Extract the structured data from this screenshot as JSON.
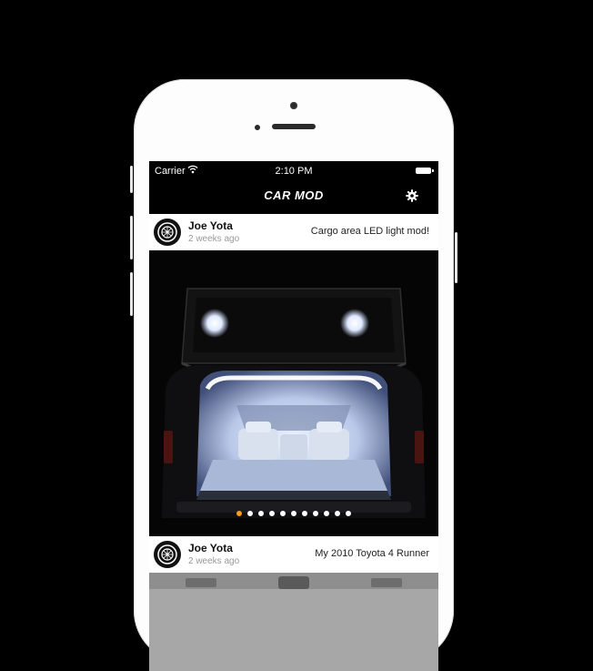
{
  "status_bar": {
    "carrier": "Carrier",
    "time": "2:10 PM"
  },
  "nav": {
    "logo_text": "CAR MOD",
    "settings_icon": "gear-icon"
  },
  "posts": [
    {
      "author": "Joe Yota",
      "time_ago": "2 weeks ago",
      "title": "Cargo area LED light mod!",
      "carousel": {
        "count": 11,
        "active_index": 0
      }
    },
    {
      "author": "Joe Yota",
      "time_ago": "2 weeks ago",
      "title": "My 2010 Toyota 4 Runner"
    }
  ],
  "colors": {
    "background": "#000000",
    "accent_active_dot": "#ff9a1f",
    "header": "#ffffff"
  }
}
